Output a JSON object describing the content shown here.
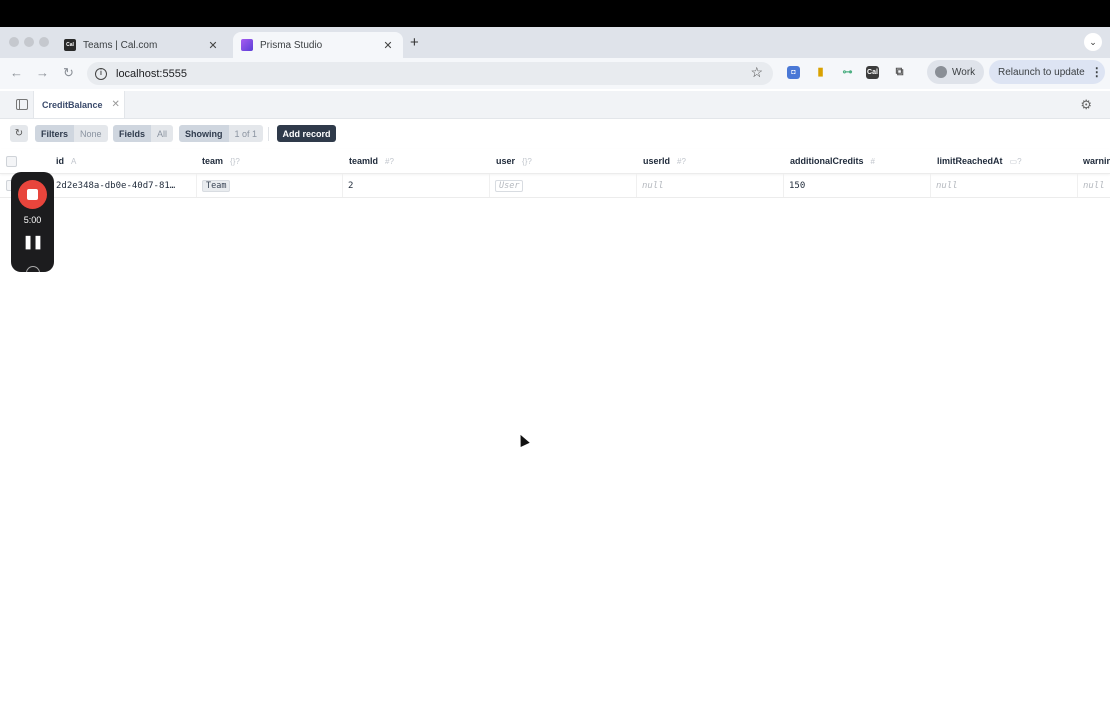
{
  "browser": {
    "tabs": [
      {
        "title": "Teams | Cal.com",
        "active": false
      },
      {
        "title": "Prisma Studio",
        "active": true
      }
    ],
    "new_tab": "+",
    "tab_search": "⌄",
    "url": "localhost:5555",
    "profile": "Work",
    "relaunch": "Relaunch to update"
  },
  "studio": {
    "model_tab": "CreditBalance",
    "toolbar": {
      "filters_label": "Filters",
      "filters_value": "None",
      "fields_label": "Fields",
      "fields_value": "All",
      "showing_label": "Showing",
      "showing_value": "1 of 1",
      "add_record": "Add record"
    },
    "columns": [
      {
        "name": "id",
        "type": "A"
      },
      {
        "name": "team",
        "type": "{}?"
      },
      {
        "name": "teamId",
        "type": "#?"
      },
      {
        "name": "user",
        "type": "{}?"
      },
      {
        "name": "userId",
        "type": "#?"
      },
      {
        "name": "additionalCredits",
        "type": "#"
      },
      {
        "name": "limitReachedAt",
        "type": "▭?"
      },
      {
        "name": "warningSentAt",
        "type": ""
      }
    ],
    "rows": [
      {
        "id": "2d2e348a-db0e-40d7-81…",
        "team": "Team",
        "teamId": "2",
        "user": "User",
        "userId": "null",
        "additionalCredits": "150",
        "limitReachedAt": "null",
        "warning": "null"
      }
    ]
  },
  "recorder": {
    "time": "5:00"
  }
}
